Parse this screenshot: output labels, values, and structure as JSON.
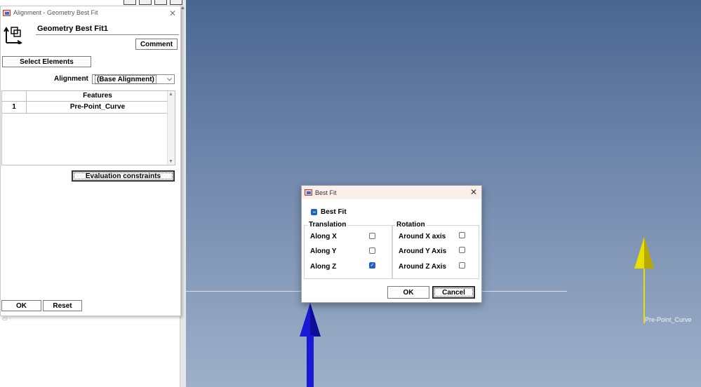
{
  "alignment_panel": {
    "window_title": "Alignment - Geometry Best Fit",
    "name_value": "Geometry Best Fit1",
    "comment_label": "Comment",
    "select_elements_label": "Select Elements",
    "alignment_label": "Alignment",
    "alignment_value": "(Base Alignment)",
    "table": {
      "header_features": "Features",
      "rows": [
        {
          "num": "1",
          "feature": "Pre-Point_Curve"
        }
      ]
    },
    "evaluation_constraints_label": "Evaluation constraints",
    "ok_label": "OK",
    "reset_label": "Reset"
  },
  "best_fit_dialog": {
    "title": "Best Fit",
    "best_fit_label": "Best Fit",
    "translation_title": "Translation",
    "rotation_title": "Rotation",
    "translation": [
      {
        "label": "Along X",
        "checked": false
      },
      {
        "label": "Along Y",
        "checked": false
      },
      {
        "label": "Along Z",
        "checked": true
      }
    ],
    "rotation": [
      {
        "label": "Around X axis",
        "checked": false
      },
      {
        "label": "Around Y Axis",
        "checked": false
      },
      {
        "label": "Around Z Axis",
        "checked": false
      }
    ],
    "ok_label": "OK",
    "cancel_label": "Cancel"
  },
  "viewport": {
    "curve_label": "Pre-Point_Curve"
  },
  "colors": {
    "accent": "#1f63c8",
    "arrow_blue": "#1a1ad6",
    "arrow_yellow": "#e8e000"
  }
}
